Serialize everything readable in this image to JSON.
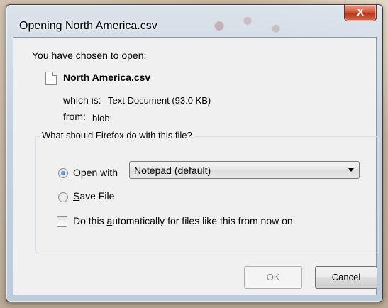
{
  "dialog": {
    "title": "Opening North America.csv",
    "close_label": "X",
    "chosen_label": "You have chosen to open:",
    "file_name": "North America.csv",
    "which_is_label": "which is:",
    "which_is_value": "Text Document (93.0 KB)",
    "from_label": "from:",
    "from_value": "blob:",
    "question": "What should Firefox do with this file?",
    "open_with": {
      "access_key": "O",
      "label_rest": "pen with",
      "selected": true
    },
    "app_select": {
      "value": "Notepad (default)"
    },
    "save_file": {
      "access_key": "S",
      "label_rest": "ave File",
      "selected": false
    },
    "auto_checkbox": {
      "label_pre": "Do this ",
      "access_key": "a",
      "label_post": "utomatically for files like this from now on.",
      "checked": false
    },
    "ok_label": "OK",
    "cancel_label": "Cancel"
  }
}
